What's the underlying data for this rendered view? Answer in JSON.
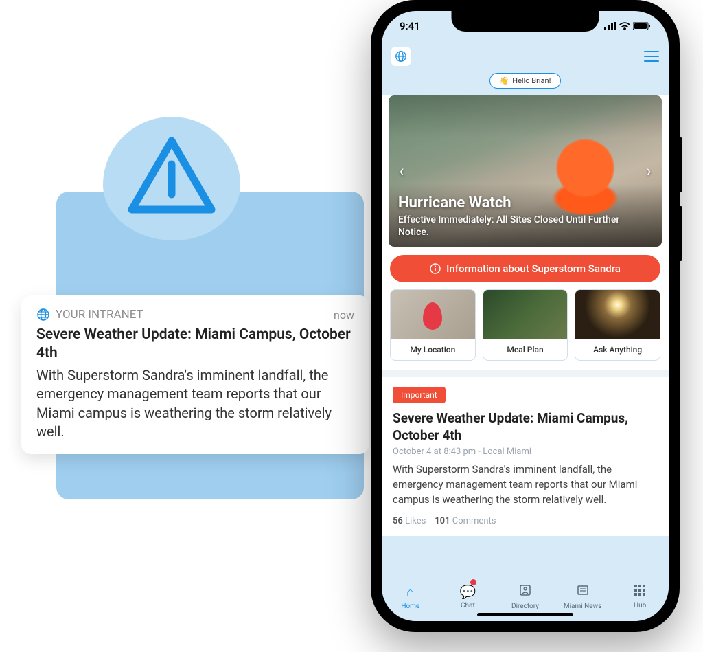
{
  "notification": {
    "app_name": "YOUR INTRANET",
    "time_label": "now",
    "title": "Severe Weather Update: Miami Campus, October 4th",
    "body": "With Superstorm Sandra's imminent landfall, the emergency management team reports that our Miami campus is weathering the storm relatively well."
  },
  "phone": {
    "status": {
      "time": "9:41"
    },
    "greeting": "Hello Brian!",
    "hero": {
      "title": "Hurricane Watch",
      "subtitle": "Effective Immediately: All Sites Closed Until Further Notice."
    },
    "alert_button": "Information about Superstorm Sandra",
    "tiles": [
      {
        "label": "My Location"
      },
      {
        "label": "Meal Plan"
      },
      {
        "label": "Ask Anything"
      }
    ],
    "post": {
      "badge": "Important",
      "title": "Severe Weather Update: Miami Campus, October 4th",
      "meta": "October 4 at 8:43 pm - Local Miami",
      "body": "With Superstorm Sandra's imminent landfall, the emergency management team reports that our Miami campus is weathering the storm relatively well.",
      "likes_count": "56",
      "likes_label": "Likes",
      "comments_count": "101",
      "comments_label": "Comments"
    },
    "tabs": [
      {
        "label": "Home"
      },
      {
        "label": "Chat"
      },
      {
        "label": "Directory"
      },
      {
        "label": "Miami News"
      },
      {
        "label": "Hub"
      }
    ]
  }
}
